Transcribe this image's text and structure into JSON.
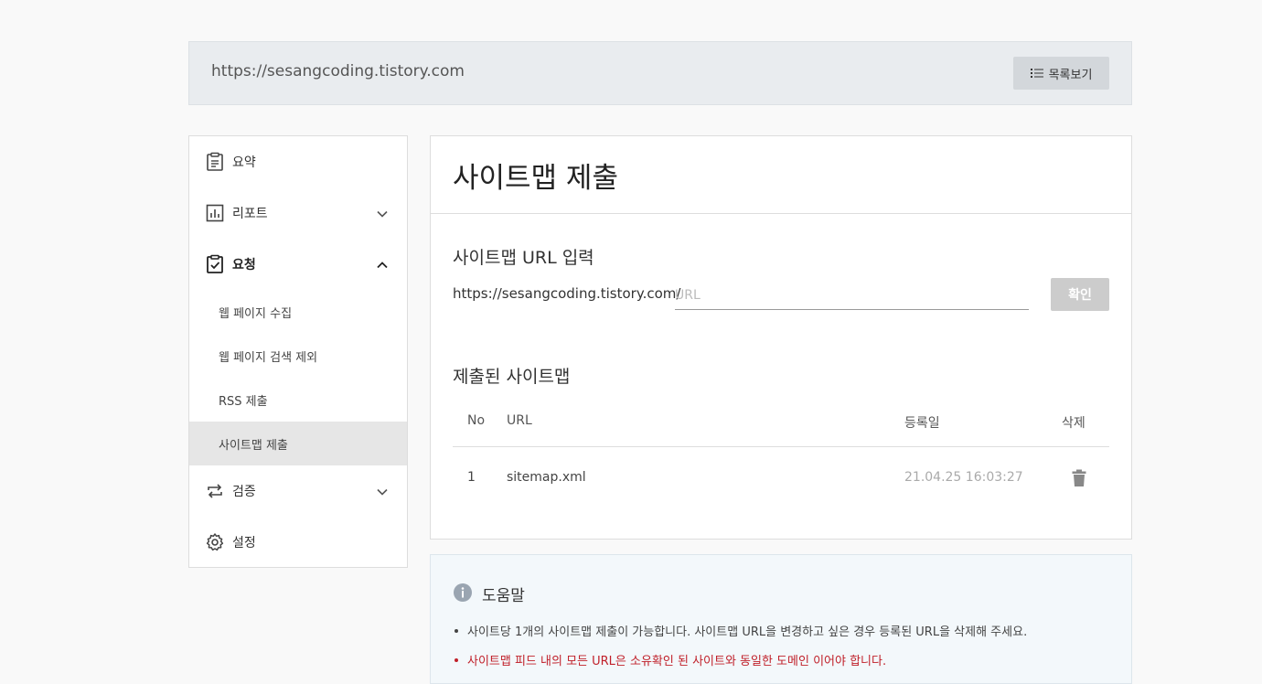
{
  "site": {
    "url": "https://sesangcoding.tistory.com",
    "list_button_label": "목록보기"
  },
  "sidebar": {
    "items": [
      {
        "label": "요약",
        "icon": "clipboard-icon"
      },
      {
        "label": "리포트",
        "icon": "bar-chart-icon"
      },
      {
        "label": "요청",
        "icon": "clipboard-check-icon"
      },
      {
        "label": "검증",
        "icon": "repeat-icon"
      },
      {
        "label": "설정",
        "icon": "gear-icon"
      }
    ],
    "subitems": [
      {
        "label": "웹 페이지 수집"
      },
      {
        "label": "웹 페이지 검색 제외"
      },
      {
        "label": "RSS 제출"
      },
      {
        "label": "사이트맵 제출",
        "active": true
      }
    ]
  },
  "main": {
    "title": "사이트맵 제출",
    "input_section_title": "사이트맵 URL 입력",
    "url_prefix": "https://sesangcoding.tistory.com/",
    "url_placeholder": "URL",
    "url_value": "",
    "confirm_label": "확인",
    "submitted_title": "제출된 사이트맵",
    "table": {
      "headers": {
        "no": "No",
        "url": "URL",
        "date": "등록일",
        "delete": "삭제"
      },
      "rows": [
        {
          "no": "1",
          "url": "sitemap.xml",
          "date": "21.04.25 16:03:27"
        }
      ]
    }
  },
  "help": {
    "title": "도움말",
    "items": [
      {
        "text": "사이트당 1개의 사이트맵 제출이 가능합니다. 사이트맵 URL을 변경하고 싶은 경우 등록된 URL을 삭제해 주세요."
      },
      {
        "text": "사이트맵 피드 내의 모든 URL은 소유확인 된 사이트와 동일한 도메인 이어야 합니다.",
        "highlight": true
      }
    ]
  },
  "colors": {
    "highlight_text": "#c0202a",
    "active_nav_bg": "#e6e6e6",
    "disabled_button": "#cccccc"
  }
}
